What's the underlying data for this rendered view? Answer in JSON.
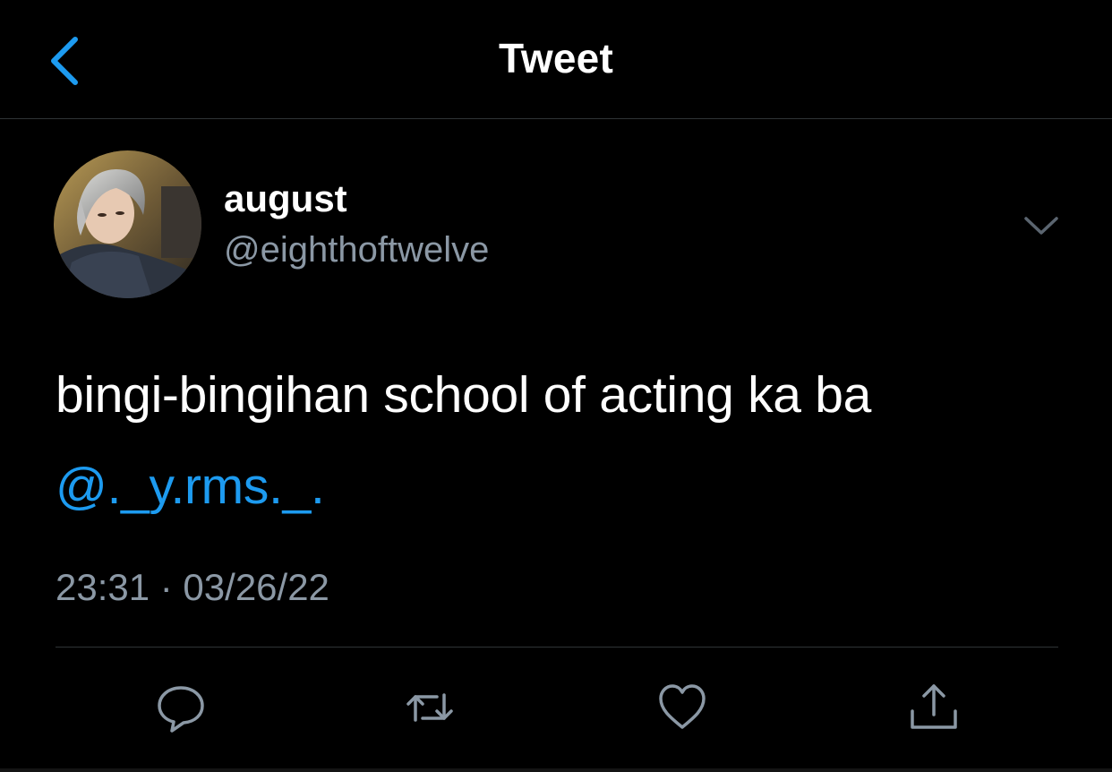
{
  "nav": {
    "title": "Tweet",
    "back_icon": "chevron-left-icon"
  },
  "author": {
    "display_name": "august",
    "handle": "@eighthoftwelve",
    "avatar": "profile-photo"
  },
  "tweet": {
    "text": "bingi-bingihan school of acting ka ba",
    "mention": "@._y.rms._.",
    "timestamp": "23:31 · 03/26/22"
  },
  "actions": [
    {
      "icon": "reply-icon"
    },
    {
      "icon": "retweet-icon"
    },
    {
      "icon": "like-icon"
    },
    {
      "icon": "share-icon"
    }
  ],
  "colors": {
    "background": "#000000",
    "accent": "#1d9bf0",
    "secondary_text": "#8b98a5",
    "divider": "#2f3336"
  }
}
